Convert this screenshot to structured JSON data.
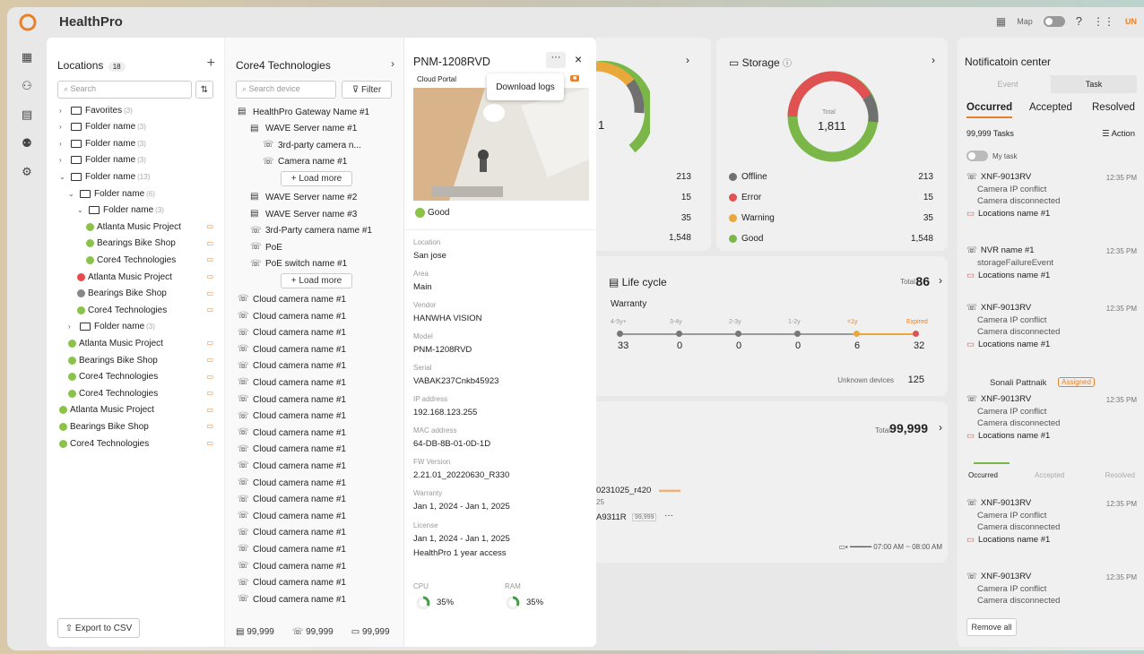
{
  "app": {
    "brand": "HealthPro",
    "map_label": "Map",
    "avatar": "UN"
  },
  "rail": [
    "grid-icon",
    "user-icon",
    "document-icon",
    "badge-icon",
    "gear-icon"
  ],
  "locations": {
    "title": "Locations",
    "count": "18",
    "search_placeholder": "Search",
    "rows": [
      {
        "label": "Favorites",
        "count": "(3)",
        "kind": "folder",
        "chev": ">",
        "indent": 0
      },
      {
        "label": "Folder name",
        "count": "(3)",
        "kind": "folder",
        "chev": ">",
        "indent": 0
      },
      {
        "label": "Folder name",
        "count": "(3)",
        "kind": "folder",
        "chev": ">",
        "indent": 0
      },
      {
        "label": "Folder name",
        "count": "(3)",
        "kind": "folder",
        "chev": ">",
        "indent": 0
      },
      {
        "label": "Folder name",
        "count": "(13)",
        "kind": "folder",
        "chev": "v",
        "indent": 0
      },
      {
        "label": "Folder name",
        "count": "(6)",
        "kind": "folder",
        "chev": "v",
        "indent": 1
      },
      {
        "label": "Folder name",
        "count": "(3)",
        "kind": "folder",
        "chev": "v",
        "indent": 2
      },
      {
        "label": "Atlanta Music Project",
        "count": "",
        "kind": "green",
        "chev": "",
        "indent": 3
      },
      {
        "label": "Bearings Bike Shop",
        "count": "",
        "kind": "green",
        "chev": "",
        "indent": 3
      },
      {
        "label": "Core4 Technologies",
        "count": "",
        "kind": "green",
        "chev": "",
        "indent": 3
      },
      {
        "label": "Atlanta Music Project",
        "count": "",
        "kind": "red",
        "chev": "",
        "indent": 2
      },
      {
        "label": "Bearings Bike Shop",
        "count": "",
        "kind": "grey",
        "chev": "",
        "indent": 2
      },
      {
        "label": "Core4 Technologies",
        "count": "",
        "kind": "green",
        "chev": "",
        "indent": 2
      },
      {
        "label": "Folder name",
        "count": "(3)",
        "kind": "folder",
        "chev": ">",
        "indent": 1
      },
      {
        "label": "Atlanta Music Project",
        "count": "",
        "kind": "green",
        "chev": "",
        "indent": 1
      },
      {
        "label": "Bearings Bike Shop",
        "count": "",
        "kind": "green",
        "chev": "",
        "indent": 1
      },
      {
        "label": "Core4 Technologies",
        "count": "",
        "kind": "green",
        "chev": "",
        "indent": 1
      },
      {
        "label": "Core4 Technologies",
        "count": "",
        "kind": "green",
        "chev": "",
        "indent": 1
      },
      {
        "label": "Atlanta Music Project",
        "count": "",
        "kind": "green",
        "chev": "",
        "indent": 0
      },
      {
        "label": "Bearings Bike Shop",
        "count": "",
        "kind": "green",
        "chev": "",
        "indent": 0
      },
      {
        "label": "Core4 Technologies",
        "count": "",
        "kind": "green",
        "chev": "",
        "indent": 0
      }
    ],
    "export_label": "Export to CSV"
  },
  "devices": {
    "title": "Core4 Technologies",
    "search_placeholder": "Search device",
    "filter_label": "Filter",
    "tree": [
      {
        "label": "HealthPro Gateway  Name #1",
        "indent": 0
      },
      {
        "label": "WAVE Server name #1",
        "indent": 1
      },
      {
        "label": "3rd-party camera n...",
        "indent": 2
      },
      {
        "label": "Camera name #1",
        "indent": 2
      }
    ],
    "load_more": "Load more",
    "tree2": [
      {
        "label": "WAVE Server name #2",
        "indent": 1
      },
      {
        "label": "WAVE Server name #3",
        "indent": 1
      },
      {
        "label": "3rd-Party camera name #1",
        "indent": 1
      },
      {
        "label": "PoE",
        "indent": 1
      },
      {
        "label": "PoE switch name #1",
        "indent": 1
      }
    ],
    "cloud_camera": "Cloud camera name #1",
    "cloud_count": 19,
    "footer": [
      "99,999",
      "99,999",
      "99,999"
    ]
  },
  "detail": {
    "title": "PNM-1208RVD",
    "cloud_portal": "Cloud Portal",
    "tooltip": "Download logs",
    "status": "Good",
    "fields": [
      {
        "label": "Location",
        "value": "San jose"
      },
      {
        "label": "Area",
        "value": "Main"
      },
      {
        "label": "Vendor",
        "value": "HANWHA VISION"
      },
      {
        "label": "Model",
        "value": "PNM-1208RVD"
      },
      {
        "label": "Serial",
        "value": "VABAK237Cnkb45923"
      },
      {
        "label": "IP address",
        "value": "192.168.123.255"
      },
      {
        "label": "MAC address",
        "value": "64-DB-8B-01-0D-1D"
      },
      {
        "label": "FW Version",
        "value": "2.21.01_20220630_R330"
      },
      {
        "label": "Warranty",
        "value": "Jan 1, 2024 - Jan 1, 2025"
      }
    ],
    "license_label": "License",
    "license_value1": "Jan 1, 2024 - Jan 1, 2025",
    "license_value2": "HealthPro 1 year access",
    "cpu_label": "CPU",
    "cpu_value": "35%",
    "ram_label": "RAM",
    "ram_value": "35%"
  },
  "cards": {
    "left_stats": [
      "213",
      "15",
      "35",
      "1,548"
    ],
    "donut1_text": "1",
    "storage_title": "Storage",
    "storage_total_label": "Total",
    "storage_total": "1,811",
    "storage_rows": [
      {
        "label": "Offline",
        "value": "213"
      },
      {
        "label": "Error",
        "value": "15"
      },
      {
        "label": "Warning",
        "value": "35"
      },
      {
        "label": "Good",
        "value": "1,548"
      }
    ],
    "lifecycle_title": "Life cycle",
    "lifecycle_total_label": "Total",
    "lifecycle_total": "86",
    "warranty_label": "Warranty",
    "lifecycle_steps": [
      {
        "label": "4-5y+",
        "value": "33"
      },
      {
        "label": "3-4y",
        "value": "0"
      },
      {
        "label": "2-3y",
        "value": "0"
      },
      {
        "label": "1-2y",
        "value": "0"
      },
      {
        "label": "<1y",
        "value": "6"
      },
      {
        "label": "Expired",
        "value": "32"
      }
    ],
    "unknown_label": "Unknown devices",
    "unknown_value": "125",
    "bottom_total_label": "Total",
    "bottom_total": "99,999",
    "bottom_line1": "0231025_r420",
    "bottom_line1b": "25",
    "bottom_line2": "A9311R",
    "bottom_tag": "99,999",
    "bottom_time": "07:00 AM ~ 08:00 AM"
  },
  "notif": {
    "title": "Notificatoin center",
    "seg": [
      "Event",
      "Task"
    ],
    "tabs": [
      "Occurred",
      "Accepted",
      "Resolved"
    ],
    "tasks_label": "99,999 Tasks",
    "action_label": "Action",
    "mytask_label": "My task",
    "items": [
      {
        "name": "XNF-9013RV",
        "l1": "Camera IP conflict",
        "l2": "Camera disconnected",
        "loc": "Locations name #1",
        "time": "12:35 PM"
      },
      {
        "name": "NVR name #1",
        "l1": "storageFailureEvent",
        "l2": "",
        "loc": "Locations name #1",
        "time": "12:35 PM"
      },
      {
        "name": "XNF-9013RV",
        "l1": "Camera IP conflict",
        "l2": "Camera disconnected",
        "loc": "Locations name #1",
        "time": "12:35 PM"
      },
      {
        "name": "XNF-9013RV",
        "l1": "Camera IP conflict",
        "l2": "Camera disconnected",
        "loc": "Locations name #1",
        "time": "12:35 PM"
      },
      {
        "name": "XNF-9013RV",
        "l1": "Camera IP conflict",
        "l2": "Camera disconnected",
        "loc": "Locations name #1",
        "time": "12:35 PM"
      },
      {
        "name": "XNF-9013RV",
        "l1": "Camera IP conflict",
        "l2": "Camera disconnected",
        "loc": "",
        "time": "12:35 PM"
      }
    ],
    "assignee": "Sonali Pattnaik",
    "assigned_tag": "Assigned",
    "progress": [
      "Occurred",
      "Accepted",
      "Resolved"
    ],
    "remove_all": "Remove all"
  }
}
